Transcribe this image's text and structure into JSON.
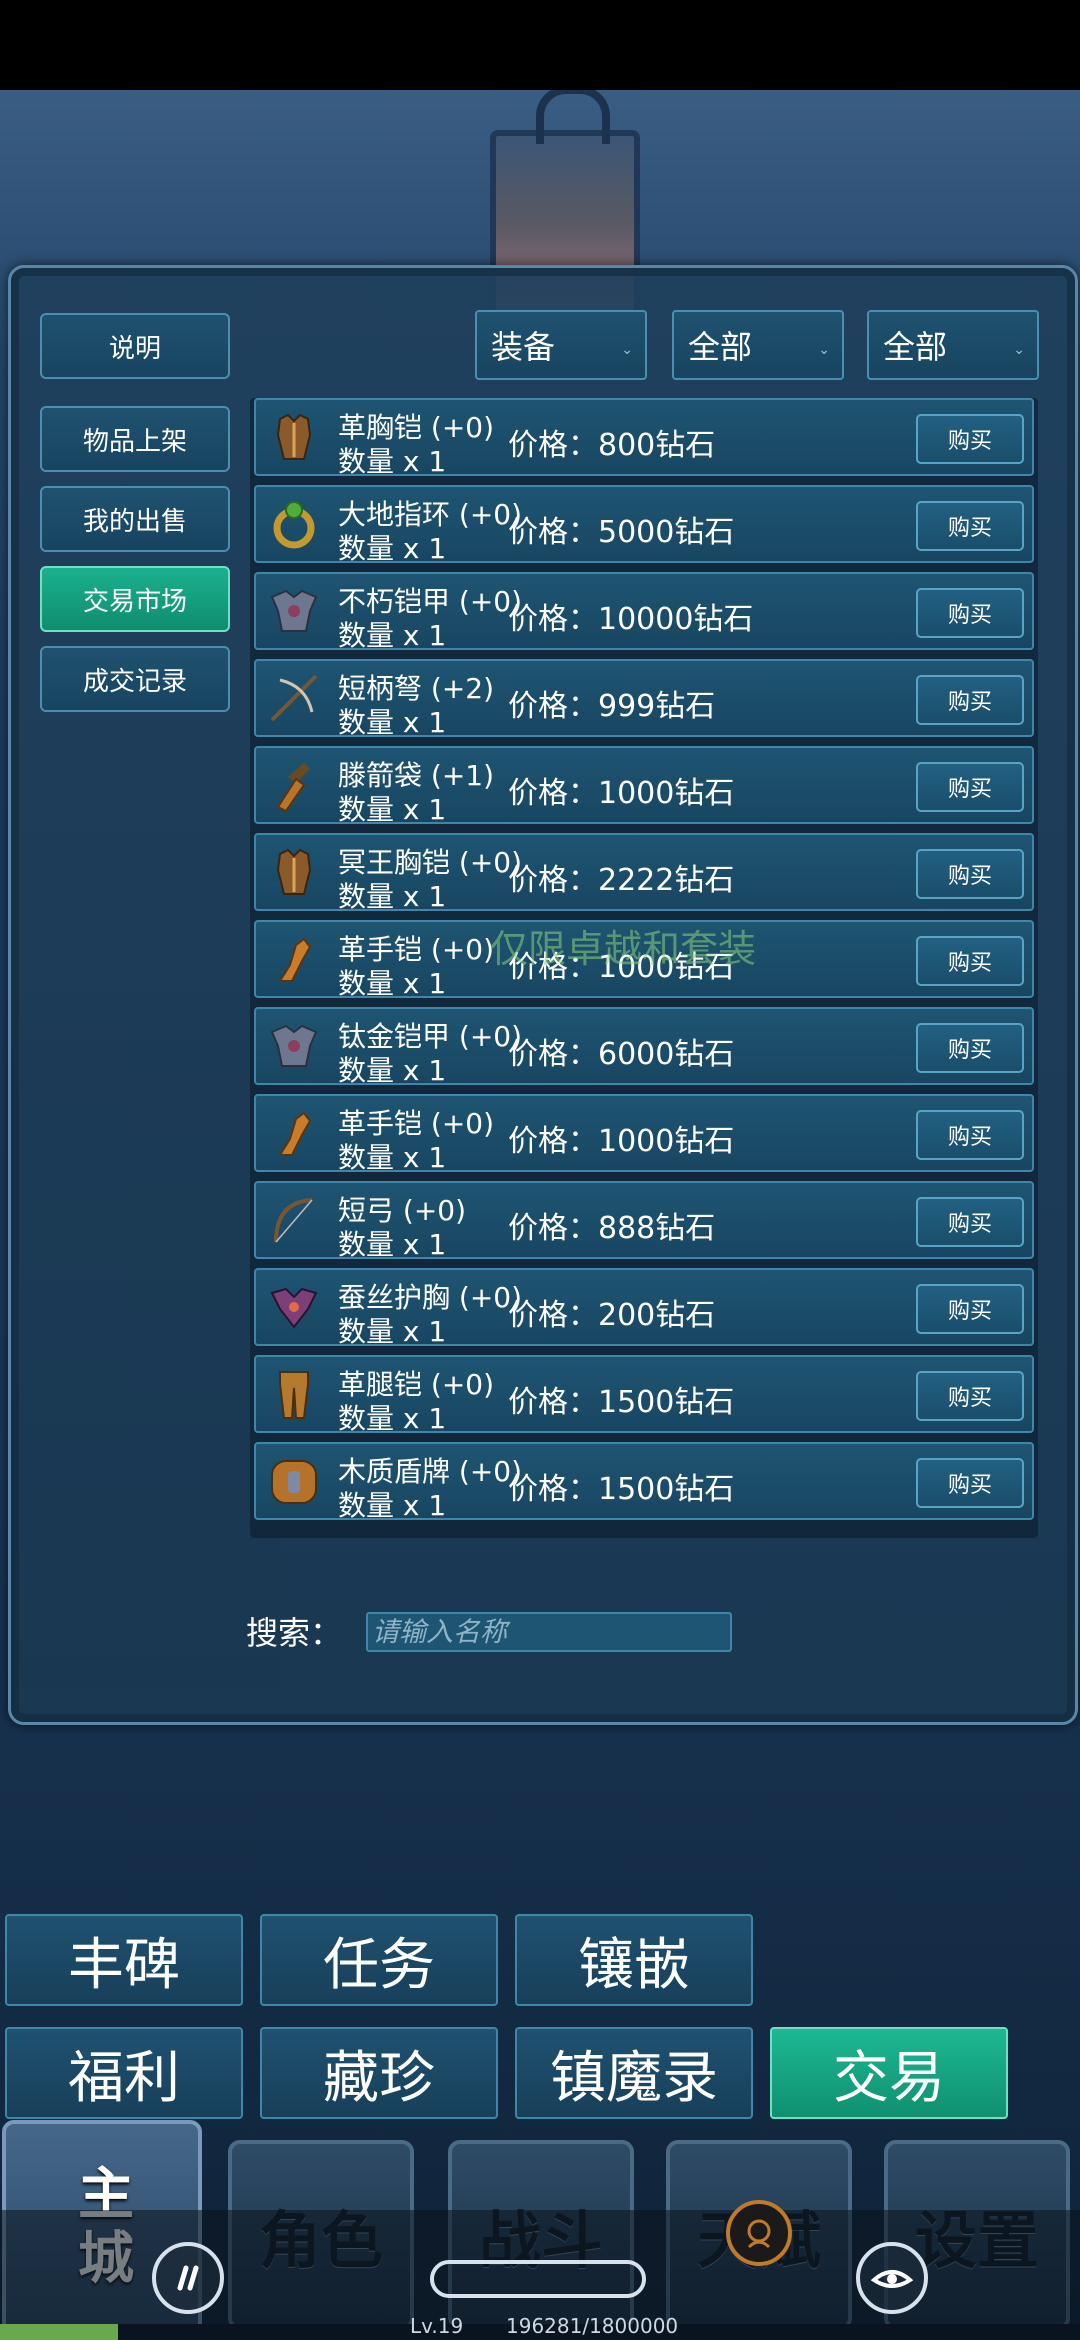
{
  "side_menu": [
    {
      "label": "说明",
      "active": false
    },
    {
      "label": "物品上架",
      "active": false
    },
    {
      "label": "我的出售",
      "active": false
    },
    {
      "label": "交易市场",
      "active": true
    },
    {
      "label": "成交记录",
      "active": false
    }
  ],
  "filters": [
    {
      "label": "装备"
    },
    {
      "label": "全部"
    },
    {
      "label": "全部"
    }
  ],
  "watermark": "仅限卓越和套装",
  "items": [
    {
      "name": "革胸铠 (+0)",
      "qty": "数量 x 1",
      "price": "价格：800钻石",
      "buy": "购买",
      "icon": "chest-armor-icon"
    },
    {
      "name": "大地指环 (+0)",
      "qty": "数量 x 1",
      "price": "价格：5000钻石",
      "buy": "购买",
      "icon": "ring-icon"
    },
    {
      "name": "不朽铠甲 (+0)",
      "qty": "数量 x 1",
      "price": "价格：10000钻石",
      "buy": "购买",
      "icon": "plate-armor-icon"
    },
    {
      "name": "短柄弩 (+2)",
      "qty": "数量 x 1",
      "price": "价格：999钻石",
      "buy": "购买",
      "icon": "crossbow-icon"
    },
    {
      "name": "滕箭袋 (+1)",
      "qty": "数量 x 1",
      "price": "价格：1000钻石",
      "buy": "购买",
      "icon": "quiver-icon"
    },
    {
      "name": "冥王胸铠 (+0)",
      "qty": "数量 x 1",
      "price": "价格：2222钻石",
      "buy": "购买",
      "icon": "chest-armor-icon"
    },
    {
      "name": "革手铠 (+0)",
      "qty": "数量 x 1",
      "price": "价格：1000钻石",
      "buy": "购买",
      "icon": "gauntlet-icon"
    },
    {
      "name": "钛金铠甲 (+0)",
      "qty": "数量 x 1",
      "price": "价格：6000钻石",
      "buy": "购买",
      "icon": "plate-armor-icon"
    },
    {
      "name": "革手铠 (+0)",
      "qty": "数量 x 1",
      "price": "价格：1000钻石",
      "buy": "购买",
      "icon": "gauntlet-icon"
    },
    {
      "name": "短弓 (+0)",
      "qty": "数量 x 1",
      "price": "价格：888钻石",
      "buy": "购买",
      "icon": "bow-icon"
    },
    {
      "name": "蚕丝护胸 (+0)",
      "qty": "数量 x 1",
      "price": "价格：200钻石",
      "buy": "购买",
      "icon": "chest-guard-icon"
    },
    {
      "name": "革腿铠 (+0)",
      "qty": "数量 x 1",
      "price": "价格：1500钻石",
      "buy": "购买",
      "icon": "leg-armor-icon"
    },
    {
      "name": "木质盾牌 (+0)",
      "qty": "数量 x 1",
      "price": "价格：1500钻石",
      "buy": "购买",
      "icon": "shield-icon"
    }
  ],
  "search": {
    "label": "搜索：",
    "placeholder": "请输入名称"
  },
  "menu_row1": [
    {
      "label": "丰碑"
    },
    {
      "label": "任务"
    },
    {
      "label": "镶嵌"
    }
  ],
  "menu_row2": [
    {
      "label": "福利"
    },
    {
      "label": "藏珍"
    },
    {
      "label": "镇魔录"
    },
    {
      "label": "交易",
      "active": true
    }
  ],
  "bottom_nav": [
    {
      "label": "主城",
      "active": true
    },
    {
      "label": "角色"
    },
    {
      "label": "战斗"
    },
    {
      "label": "天赋"
    },
    {
      "label": "设置"
    }
  ],
  "status": {
    "level": "Lv.19",
    "xp": "196281/1800000",
    "xp_fraction": 0.109
  },
  "colors": {
    "accent": "#1bb18e",
    "panel": "#1a3856",
    "row_border": "#3f87a9"
  }
}
